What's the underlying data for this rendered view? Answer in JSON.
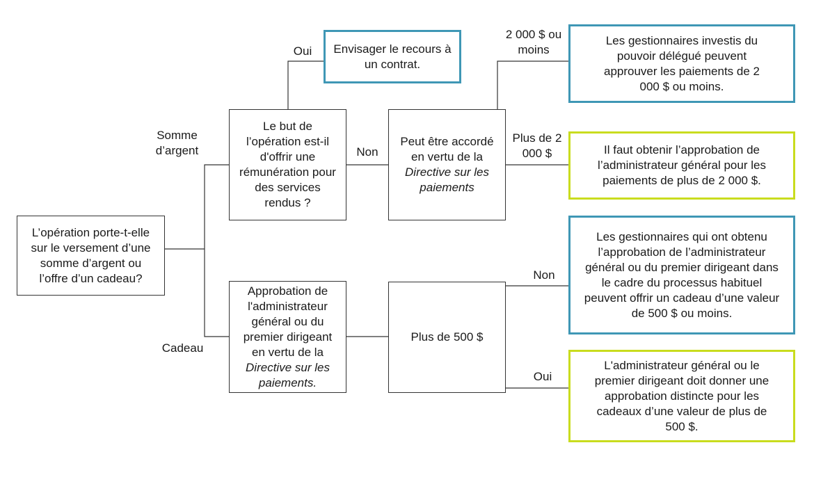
{
  "colors": {
    "outcome_blue": "#3f97b5",
    "outcome_green": "#c9dc1e",
    "line": "#333333"
  },
  "nodes": {
    "start": "L’opération porte-t-elle sur le versement d’une somme d’argent ou l’offre d’un cadeau?",
    "remuneration_question": "Le but de l’opération est-il d'offrir une rémunération pour des services rendus ?",
    "gift_approval": {
      "text": "Approbation de l'administrateur général ou du premier dirigeant en vertu de la",
      "italic": "Directive sur les paiements."
    },
    "directive_question": {
      "text": "Peut être accordé en vertu de la",
      "italic": "Directive sur les paiements"
    },
    "over_500": "Plus de 500 $",
    "contract": "Envisager le recours à un contrat.",
    "delegated_2000": "Les gestionnaires investis du pouvoir délégué peuvent approuver les paiements de 2 000 $ ou moins.",
    "dg_over_2000": "Il faut obtenir l’approbation de l’administrateur général pour les paiements de plus de 2 000 $.",
    "gift_500_or_less": "Les gestionnaires qui ont obtenu l’approbation de l’administrateur général ou du premier dirigeant dans le cadre du processus habituel peuvent offrir un cadeau d’une valeur de 500 $ ou moins.",
    "gift_over_500": "L'administrateur général ou le premier dirigeant doit donner une approbation distincte pour les cadeaux d’une valeur de plus de 500 $."
  },
  "edge_labels": {
    "money": "Somme d’argent",
    "gift": "Cadeau",
    "yes_contract": "Oui",
    "no_directive": "Non",
    "le_2000": "2 000 $ ou moins",
    "gt_2000": "Plus de 2 000 $",
    "no_500": "Non",
    "yes_500": "Oui"
  }
}
